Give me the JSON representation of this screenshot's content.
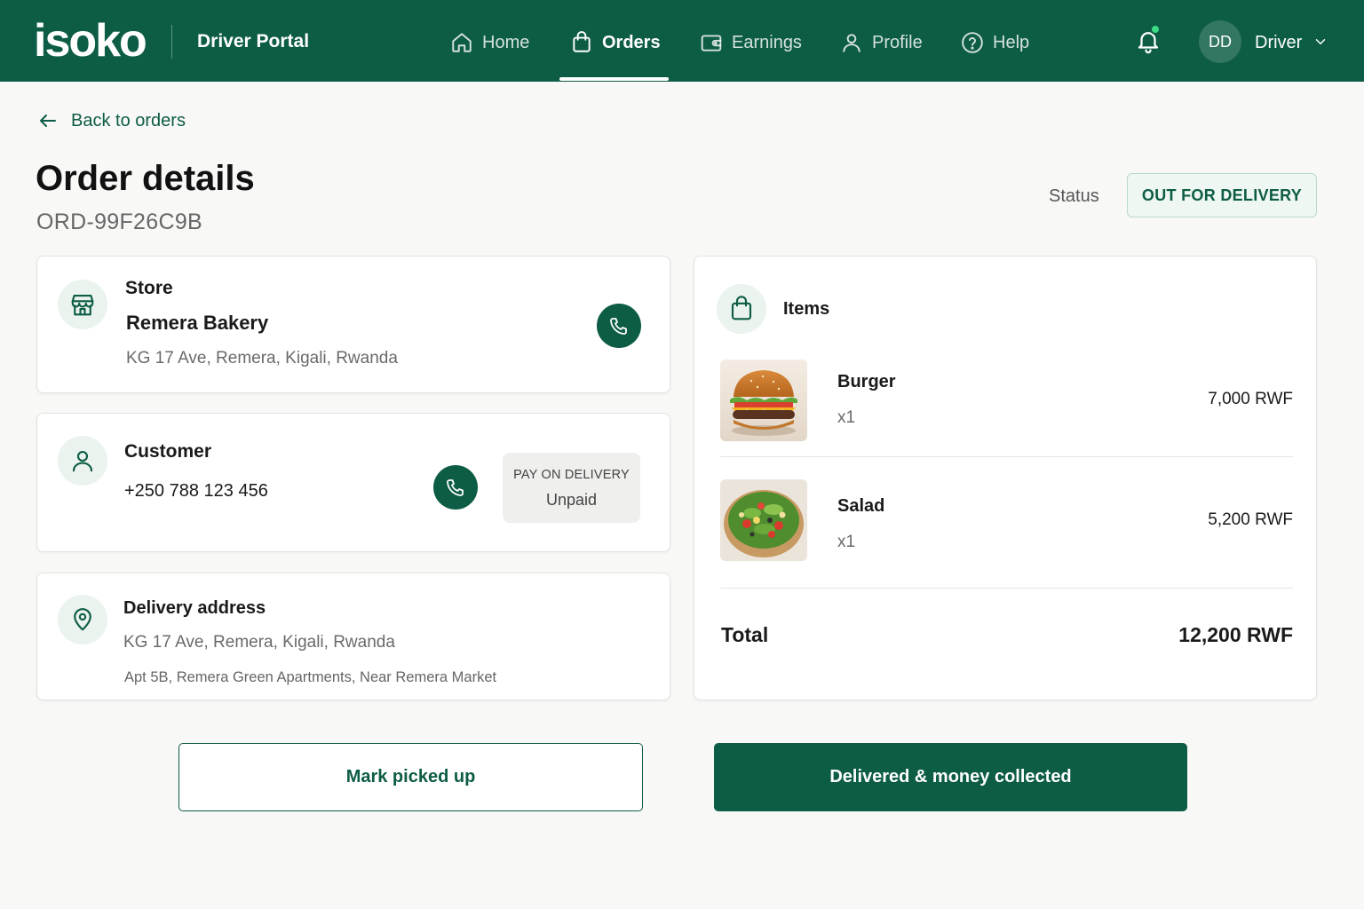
{
  "app": {
    "logo": "isoko",
    "portal_title": "Driver Portal"
  },
  "nav": {
    "items": [
      {
        "label": "Home",
        "icon": "home-icon"
      },
      {
        "label": "Orders",
        "icon": "shopping-bag-icon",
        "active": true
      },
      {
        "label": "Earnings",
        "icon": "wallet-icon"
      },
      {
        "label": "Profile",
        "icon": "user-icon"
      },
      {
        "label": "Help",
        "icon": "help-circle-icon"
      }
    ]
  },
  "user": {
    "initials": "DD",
    "name": "Driver",
    "has_notification": true
  },
  "page": {
    "back_label": "Back to orders",
    "title": "Order details",
    "order_id": "ORD-99F26C9B",
    "status_label": "Status",
    "status_value": "OUT FOR DELIVERY"
  },
  "store": {
    "heading": "Store",
    "name": "Remera Bakery",
    "address": "KG 17 Ave, Remera, Kigali, Rwanda"
  },
  "customer": {
    "heading": "Customer",
    "phone": "+250 788 123 456",
    "payment_method": "PAY ON DELIVERY",
    "payment_status": "Unpaid"
  },
  "delivery": {
    "heading": "Delivery address",
    "address": "KG 17 Ave, Remera, Kigali, Rwanda",
    "details": "Apt 5B, Remera Green Apartments, Near Remera Market"
  },
  "items": {
    "heading": "Items",
    "list": [
      {
        "name": "Burger",
        "qty": "x1",
        "price": "7,000 RWF",
        "image": "burger-image"
      },
      {
        "name": "Salad",
        "qty": "x1",
        "price": "5,200 RWF",
        "image": "salad-image"
      }
    ],
    "total_label": "Total",
    "total_value": "12,200 RWF"
  },
  "actions": {
    "mark_picked_up": "Mark picked up",
    "delivered": "Delivered & money collected"
  },
  "colors": {
    "brand": "#0d5c45",
    "status_bg": "#eef7f1",
    "notification_dot": "#3ddc84"
  }
}
